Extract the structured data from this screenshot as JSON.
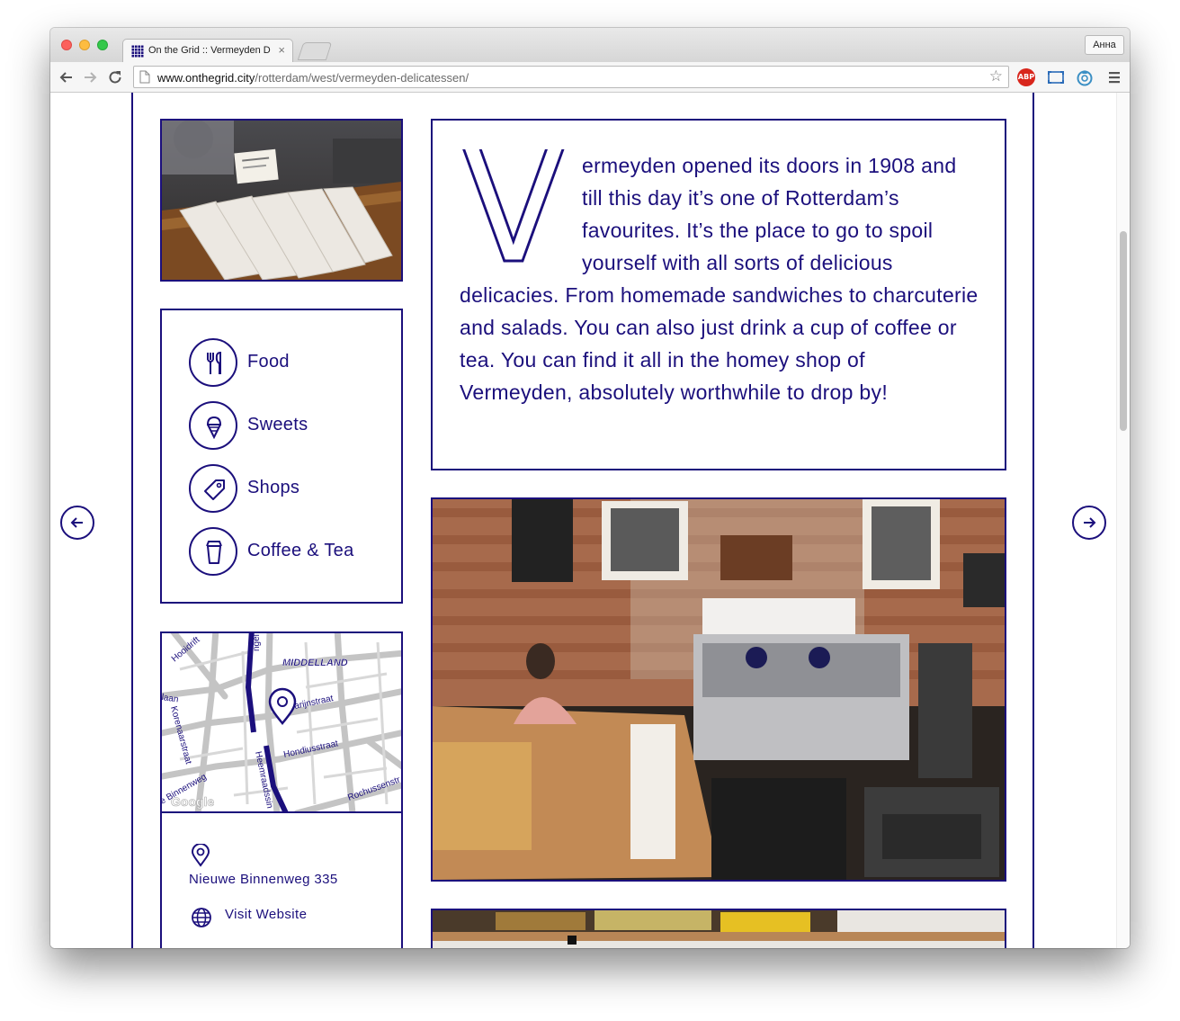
{
  "browser": {
    "tab_title": "On the Grid :: Vermeyden D",
    "tab_close": "×",
    "profile_label": "Анна",
    "url_host": "www.onthegrid.city",
    "url_path": "/rotterdam/west/vermeyden-delicatessen/",
    "adblock_label": "ABP"
  },
  "article": {
    "dropcap": "V",
    "text": "ermeyden opened its doors in 1908 and till this day it’s one of Rotterdam’s favourites. It’s the place to go to spoil yourself with all sorts of delicious delicacies. From homemade sandwiches to charcuterie and salads. You can also just drink a cup of coffee or tea. You can find it all in the homey shop of Vermeyden, absolutely worthwhile to drop by!"
  },
  "categories": [
    {
      "label": "Food",
      "icon": "fork-knife-icon"
    },
    {
      "label": "Sweets",
      "icon": "ice-cream-icon"
    },
    {
      "label": "Shops",
      "icon": "tag-icon"
    },
    {
      "label": "Coffee & Tea",
      "icon": "coffee-cup-icon"
    }
  ],
  "map": {
    "labels": {
      "district": "MIDDELLAND",
      "hooidrift": "Hooidrift",
      "singel": "ngel",
      "laan": "rlaan",
      "korenaar": "Korenaarstraat",
      "marijn": "arijnstraat",
      "hondius": "Hondiusstraat",
      "binnenweg": "e Binnenweg",
      "heemraad": "Heemraadssin",
      "rochussen": "Rochussenstr"
    },
    "attribution": "Google"
  },
  "location": {
    "address": "Nieuwe Binnenweg 335",
    "website_label": "Visit Website"
  },
  "colors": {
    "accent": "#1b0f7c",
    "background": "#ffffff"
  }
}
